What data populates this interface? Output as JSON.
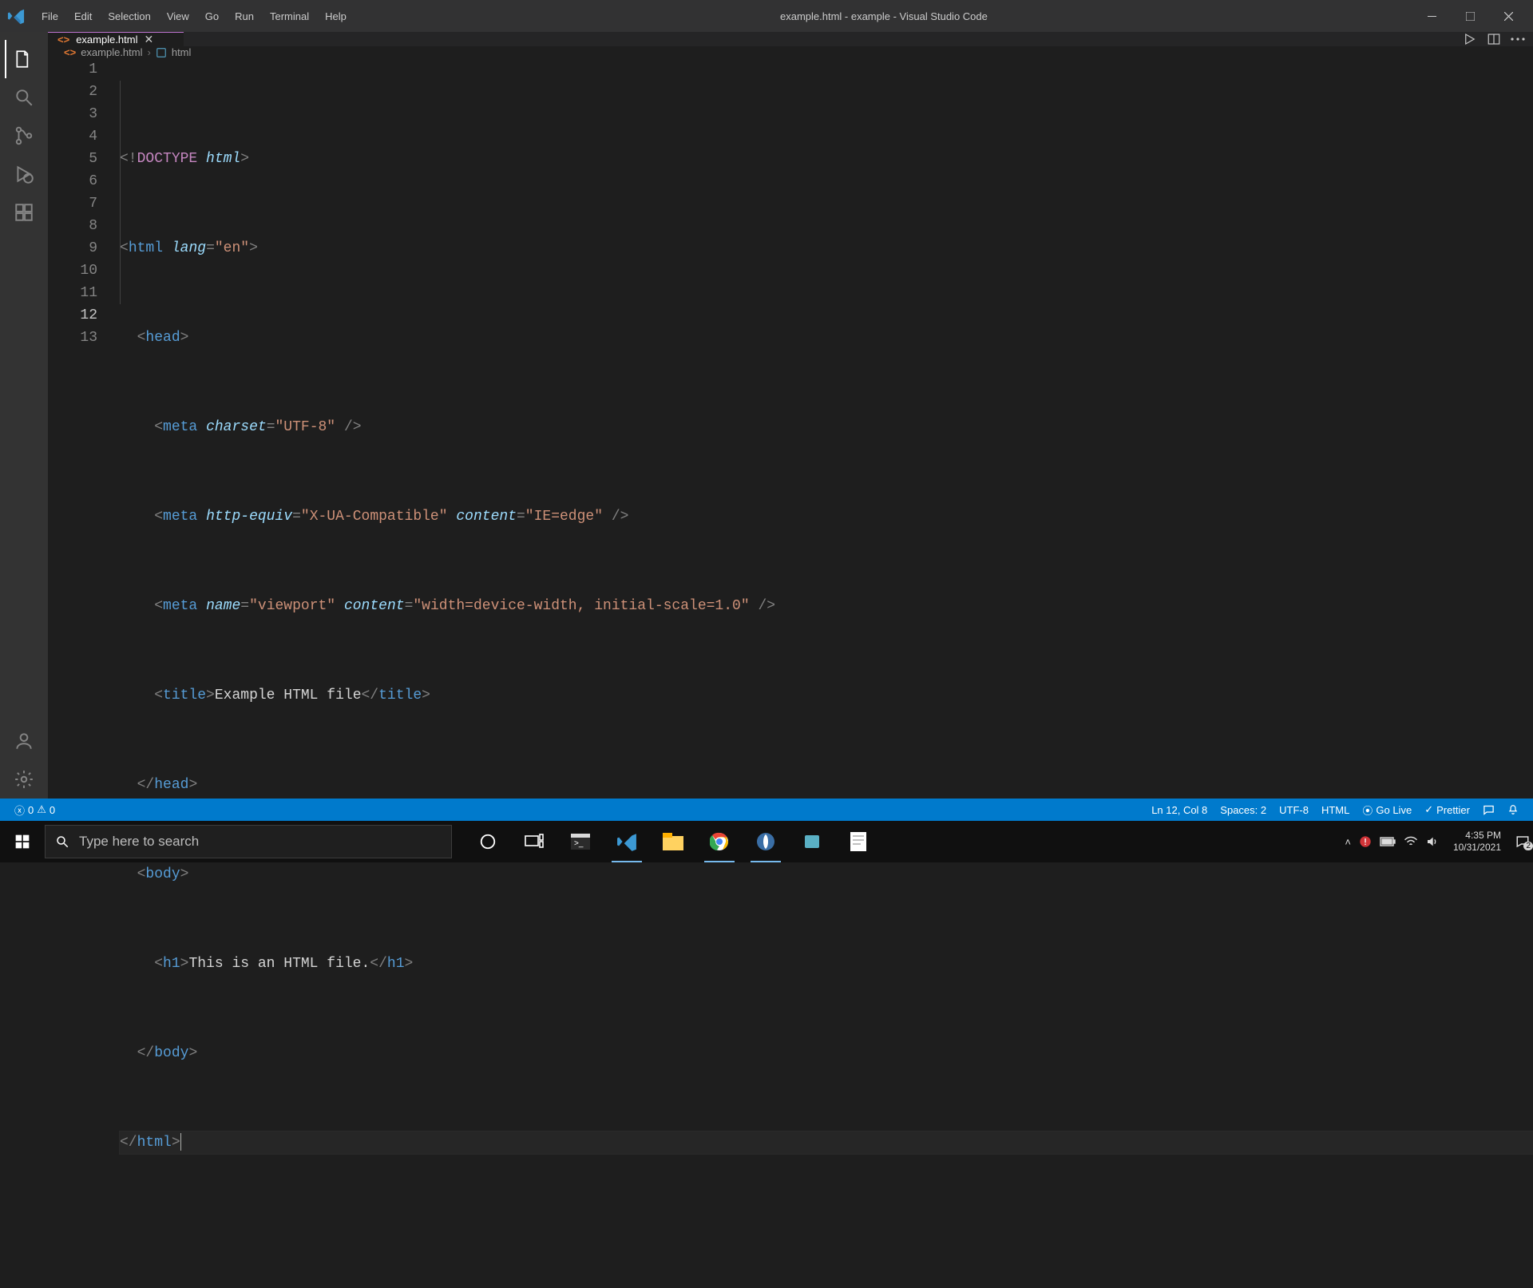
{
  "titlebar": {
    "menu": [
      "File",
      "Edit",
      "Selection",
      "View",
      "Go",
      "Run",
      "Terminal",
      "Help"
    ],
    "title": "example.html - example - Visual Studio Code"
  },
  "activitybar": {
    "items": [
      {
        "name": "explorer-icon"
      },
      {
        "name": "search-icon"
      },
      {
        "name": "source-control-icon"
      },
      {
        "name": "run-debug-icon"
      },
      {
        "name": "extensions-icon"
      }
    ],
    "bottom": [
      {
        "name": "account-icon"
      },
      {
        "name": "settings-gear-icon"
      }
    ]
  },
  "tab": {
    "filename": "example.html",
    "dirty": false
  },
  "breadcrumb": {
    "file": "example.html",
    "symbol": "html"
  },
  "editor": {
    "cursor_line": 12,
    "line_count": 13,
    "source": {
      "doctype": "DOCTYPE",
      "doctype_kind": "html",
      "html_lang_attr": "lang",
      "html_lang_val": "\"en\"",
      "meta1_attr": "charset",
      "meta1_val": "\"UTF-8\"",
      "meta2_attr1": "http-equiv",
      "meta2_val1": "\"X-UA-Compatible\"",
      "meta2_attr2": "content",
      "meta2_val2": "\"IE=edge\"",
      "meta3_attr1": "name",
      "meta3_val1": "\"viewport\"",
      "meta3_attr2": "content",
      "meta3_val2": "\"width=device-width, initial-scale=1.0\"",
      "title_text": "Example HTML file",
      "h1_text": "This is an HTML file."
    }
  },
  "statusbar": {
    "errors": "0",
    "warnings": "0",
    "position": "Ln 12, Col 8",
    "spaces": "Spaces: 2",
    "encoding": "UTF-8",
    "language": "HTML",
    "golive": "Go Live",
    "prettier": "Prettier"
  },
  "taskbar": {
    "search_placeholder": "Type here to search",
    "clock_time": "4:35 PM",
    "clock_date": "10/31/2021",
    "notification_count": "2"
  }
}
